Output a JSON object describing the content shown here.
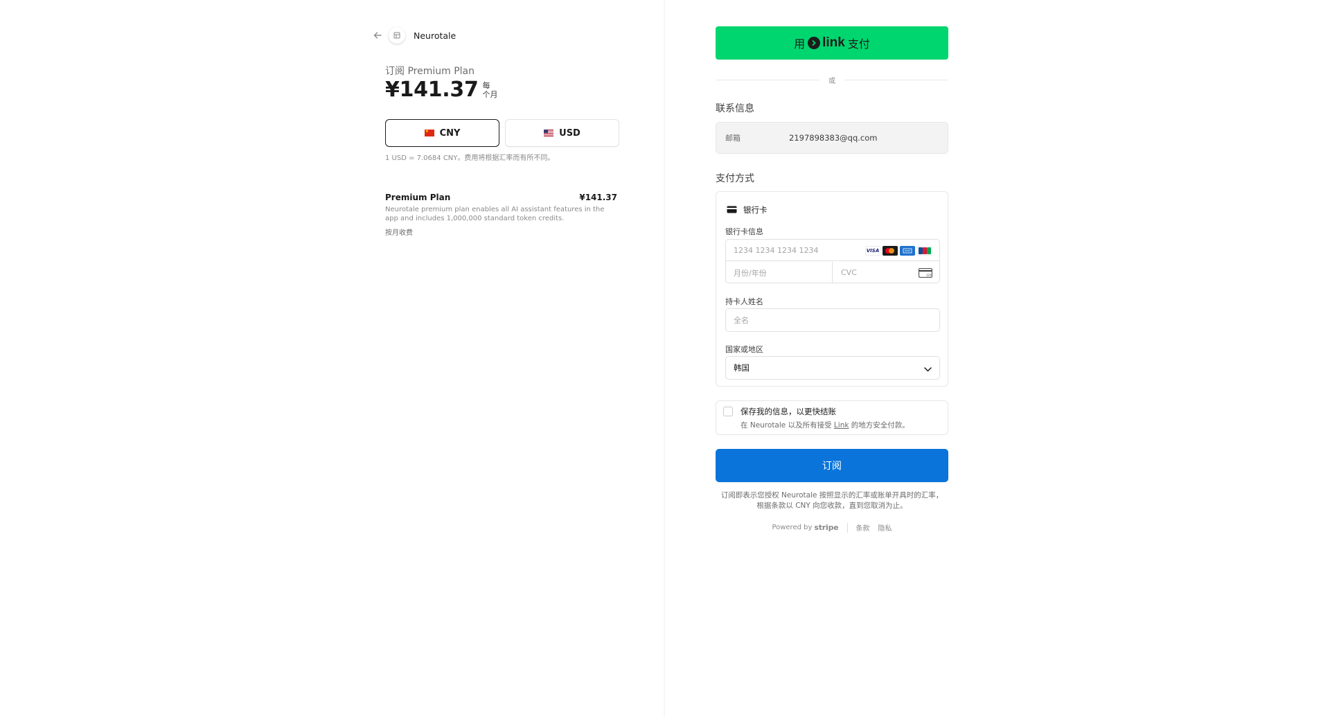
{
  "merchant": {
    "name": "Neurotale"
  },
  "summary": {
    "subscribe_label": "订阅 Premium Plan",
    "price": "¥141.37",
    "period_line1": "每",
    "period_line2": "个月",
    "currencies": [
      {
        "code": "CNY",
        "selected": true
      },
      {
        "code": "USD",
        "selected": false
      }
    ],
    "rate_note": "1 USD = 7.0684 CNY。费用将根据汇率而有所不同。",
    "line_item": {
      "name": "Premium Plan",
      "price": "¥141.37",
      "description": "Neurotale premium plan enables all AI assistant features in the app and includes 1,000,000 standard token credits.",
      "billing": "按月收费"
    }
  },
  "payment": {
    "link_button": {
      "prefix": "用",
      "brand": "link",
      "suffix": "支付"
    },
    "or_text": "或",
    "contact": {
      "title": "联系信息",
      "email_label": "邮箱",
      "email_value": "2197898383@qq.com"
    },
    "method": {
      "title": "支付方式",
      "card_label": "银行卡",
      "card_info_label": "银行卡信息",
      "card_number_placeholder": "1234 1234 1234 1234",
      "expiry_placeholder": "月份/年份",
      "cvc_placeholder": "CVC",
      "brands": [
        "VISA",
        "mastercard-icon",
        "amex-icon",
        "jcb-icon"
      ],
      "cardholder_label": "持卡人姓名",
      "cardholder_placeholder": "全名",
      "country_label": "国家或地区",
      "country_value": "韩国"
    },
    "save_info": {
      "checked": false,
      "title": "保存我的信息，以更快结账",
      "sub_prefix": "在 Neurotale 以及所有接受 ",
      "sub_link": "Link",
      "sub_suffix": " 的地方安全付款。"
    },
    "subscribe_button": "订阅",
    "legal": "订阅即表示您授权 Neurotale 按照显示的汇率或账单开具时的汇率，根据条款以 CNY 向您收款，直到您取消为止。",
    "footer": {
      "powered_by": "Powered by",
      "stripe": "stripe",
      "terms": "条款",
      "privacy": "隐私"
    },
    "colors": {
      "link_green": "#00d66f",
      "subscribe_blue": "#0a74da"
    }
  }
}
